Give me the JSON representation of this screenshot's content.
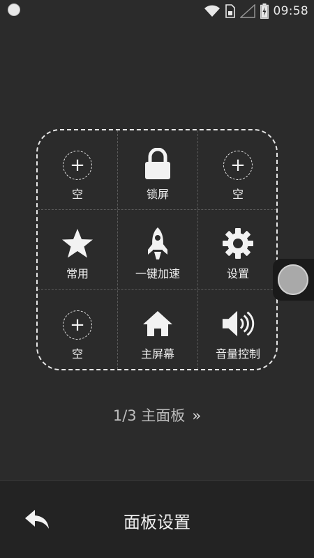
{
  "status_bar": {
    "time": "09:58",
    "icons": [
      "notification-dot-icon",
      "wifi-icon",
      "sim-card-icon",
      "signal-icon",
      "battery-charging-icon"
    ]
  },
  "panel": {
    "cells": [
      {
        "label": "空",
        "icon": "add-icon"
      },
      {
        "label": "锁屏",
        "icon": "lock-icon"
      },
      {
        "label": "空",
        "icon": "add-icon"
      },
      {
        "label": "常用",
        "icon": "star-icon"
      },
      {
        "label": "一键加速",
        "icon": "rocket-icon"
      },
      {
        "label": "设置",
        "icon": "gear-icon"
      },
      {
        "label": "空",
        "icon": "add-icon"
      },
      {
        "label": "主屏幕",
        "icon": "home-icon"
      },
      {
        "label": "音量控制",
        "icon": "volume-icon"
      }
    ]
  },
  "pager": {
    "text": "1/3 主面板",
    "next_symbol": "»"
  },
  "bottom_bar": {
    "title": "面板设置",
    "back_icon": "back-arrow-icon"
  }
}
